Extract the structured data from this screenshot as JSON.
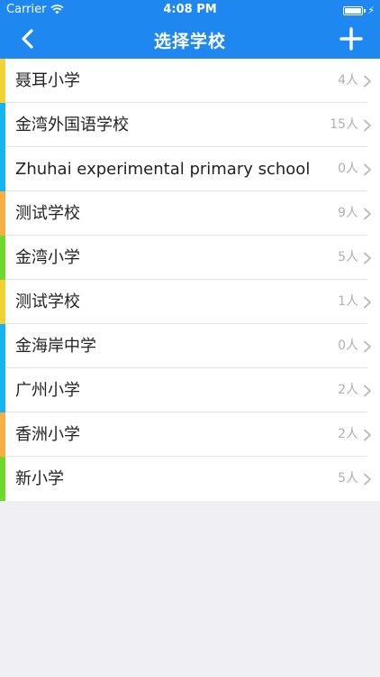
{
  "status_bar": {
    "carrier": "Carrier",
    "time": "4:08 PM"
  },
  "nav": {
    "title": "选择学校",
    "back_icon": "chevron-left-icon",
    "add_icon": "plus-icon"
  },
  "colors": {
    "header": "#1e88f0",
    "accent_yellow": "#f2d137",
    "accent_blue": "#15b4ee",
    "accent_orange": "#f7ae45",
    "accent_green": "#6fd92b"
  },
  "schools": [
    {
      "name": "聂耳小学",
      "count": "4人",
      "accent": "#f2d137"
    },
    {
      "name": "金湾外国语学校",
      "count": "15人",
      "accent": "#15b4ee"
    },
    {
      "name": "Zhuhai experimental primary school",
      "count": "0人",
      "accent": "#15b4ee"
    },
    {
      "name": "测试学校",
      "count": "9人",
      "accent": "#f7ae45"
    },
    {
      "name": "金湾小学",
      "count": "5人",
      "accent": "#6fd92b"
    },
    {
      "name": "测试学校",
      "count": "1人",
      "accent": "#f2d137"
    },
    {
      "name": "金海岸中学",
      "count": "0人",
      "accent": "#15b4ee"
    },
    {
      "name": "广州小学",
      "count": "2人",
      "accent": "#15b4ee"
    },
    {
      "name": "香洲小学",
      "count": "2人",
      "accent": "#f7ae45"
    },
    {
      "name": "新小学",
      "count": "5人",
      "accent": "#6fd92b"
    }
  ]
}
